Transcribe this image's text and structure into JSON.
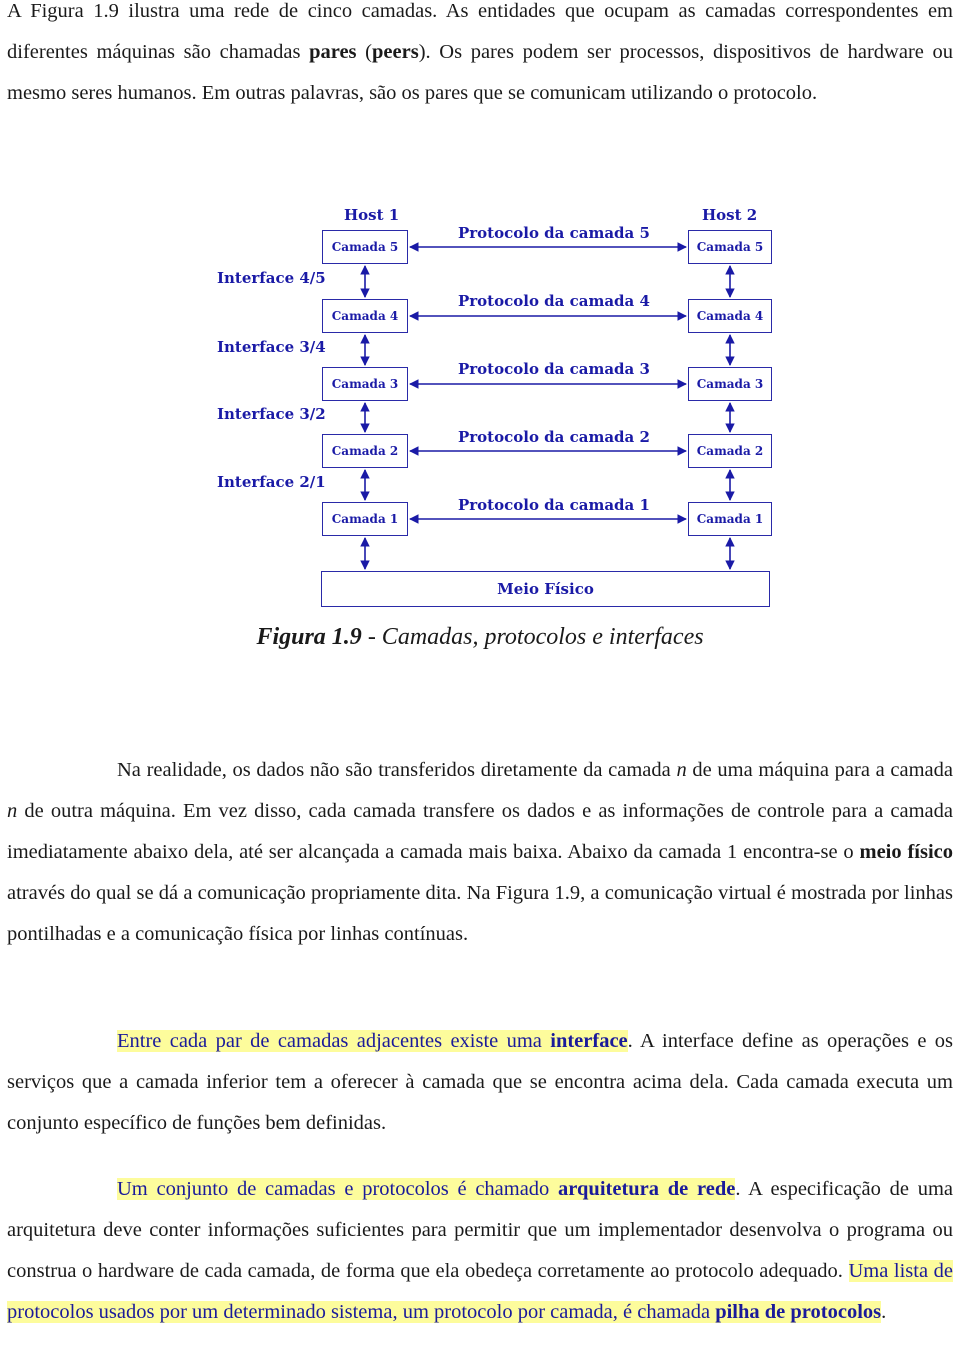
{
  "intro": {
    "part1": "A Figura 1.9 ilustra uma rede de cinco camadas. As entidades que ocupam as camadas correspondentes em diferentes máquinas são chamadas ",
    "bold1": "pares",
    "part2": " (",
    "bold2": "peers",
    "part3": "). Os pares podem ser processos, dispositivos de hardware ou mesmo seres humanos. Em outras palavras, são os pares que se comunicam utilizando o protocolo."
  },
  "figure": {
    "host1": "Host 1",
    "host2": "Host 2",
    "layers": [
      "Camada 5",
      "Camada 4",
      "Camada 3",
      "Camada 2",
      "Camada 1"
    ],
    "protocols": [
      "Protocolo da camada 5",
      "Protocolo da camada 4",
      "Protocolo da camada 3",
      "Protocolo da camada 2",
      "Protocolo da camada 1"
    ],
    "interfaces": [
      "Interface 4/5",
      "Interface 3/4",
      "Interface 3/2",
      "Interface 2/1"
    ],
    "physical": "Meio Físico",
    "caption_bold": "Figura 1.9",
    "caption_rest": " - Camadas, protocolos e interfaces",
    "color": "#1a1aa6"
  },
  "para2": {
    "t1": "Na realidade, os dados não são transferidos diretamente da camada ",
    "n1": "n",
    "t2": " de uma máquina para a camada ",
    "n2": "n",
    "t3": " de outra máquina. Em vez disso, cada camada transfere os dados e as informações de controle para a camada imediatamente abaixo dela, até ser alcançada a camada mais baixa. Abaixo da camada 1 encontra-se o ",
    "bold": "meio físico",
    "t4": " através do qual se dá a comunicação propriamente dita. Na Figura 1.9, a comunicação virtual é mostrada por linhas pontilhadas e a comunicação física por linhas contínuas."
  },
  "para3": {
    "hl1": "Entre cada par de camadas adjacentes existe uma ",
    "hlbold": "interface",
    "rest": ". A interface define as operações e os serviços que a camada inferior tem a oferecer à camada que se encontra acima dela. Cada camada executa um conjunto específico de funções bem definidas."
  },
  "para4": {
    "hl1": "Um conjunto de camadas e protocolos é chamado ",
    "hlbold1": "arquitetura de rede",
    "mid": ". A especificação de uma arquitetura deve conter informações suficientes para permitir que um implementador desenvolva o programa ou construa o hardware de cada camada, de forma que ela obedeça corretamente ao protocolo adequado. ",
    "hl2": "Uma lista de protocolos usados por um determinado sistema, um protocolo por camada, é chamada ",
    "hlbold2": "pilha de protocolos",
    "end": "."
  },
  "colors": {
    "highlight": "#fdfc9c",
    "highlight_text": "#1a1a9a"
  }
}
